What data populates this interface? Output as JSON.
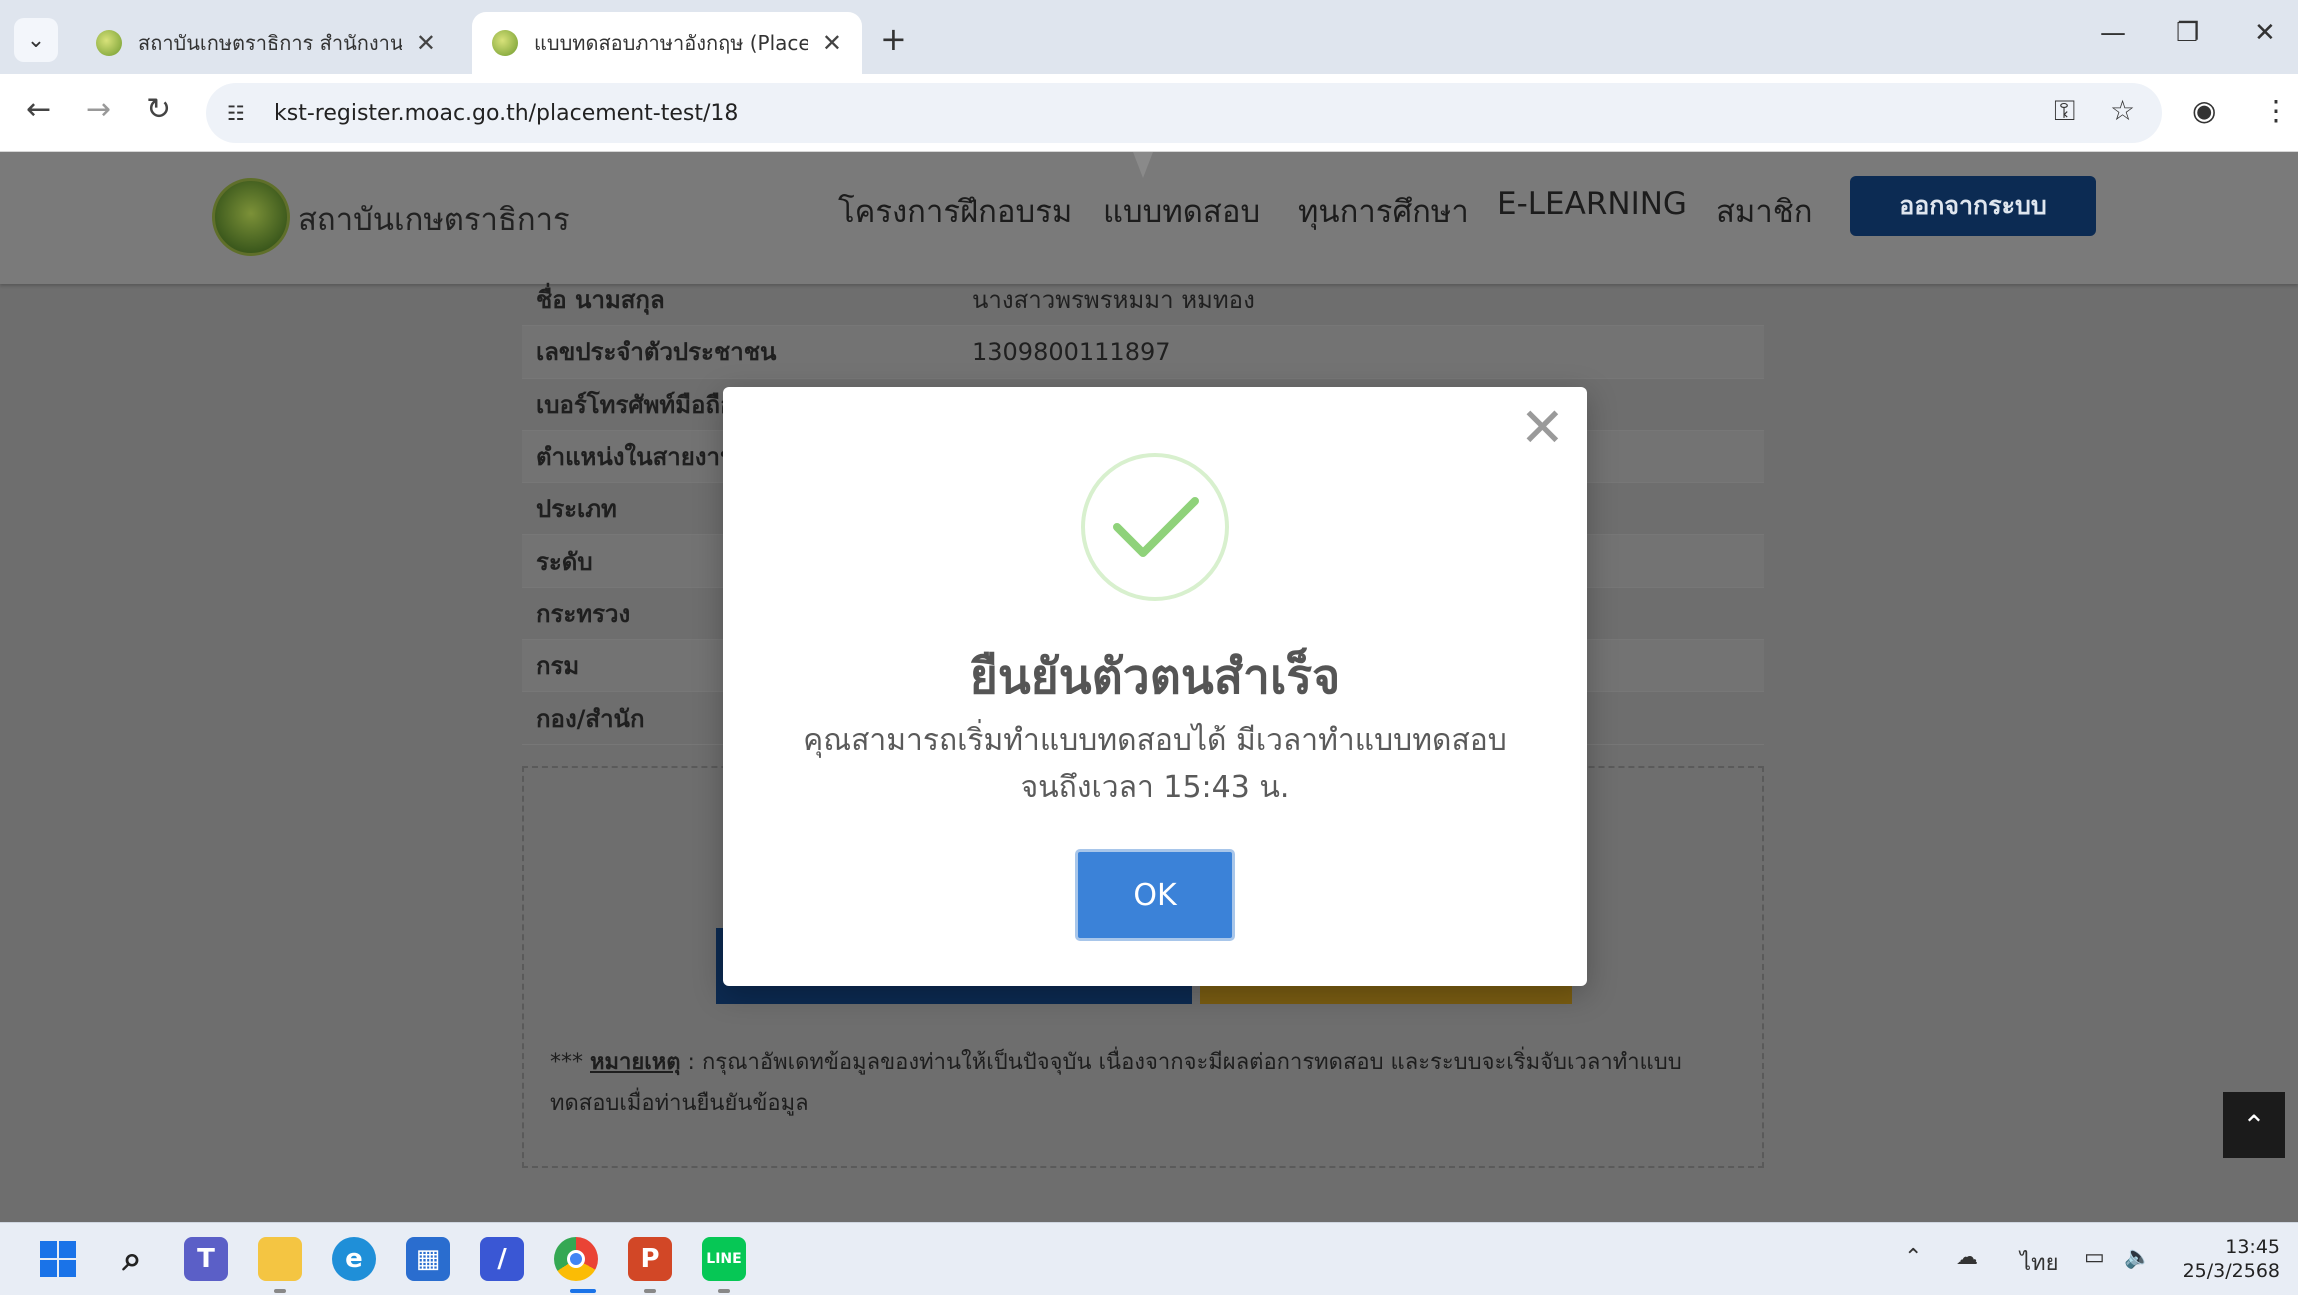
{
  "browser": {
    "tabs": [
      {
        "title": "สถาบันเกษตราธิการ สำนักงานปลัดก",
        "active": false
      },
      {
        "title": "แบบทดสอบภาษาอังกฤษ (Placemen",
        "active": true
      }
    ],
    "url": "kst-register.moac.go.th/placement-test/18"
  },
  "site": {
    "brand": "สถาบันเกษตราธิการ",
    "menu": [
      "โครงการฝึกอบรม",
      "แบบทดสอบ",
      "ทุนการศึกษา",
      "E-LEARNING",
      "สมาชิก"
    ],
    "logout": "ออกจากระบบ"
  },
  "profile_rows": [
    {
      "label": "ชื่อ นามสกุล",
      "value": "นางสาวพรพรหมมา หมทอง"
    },
    {
      "label": "เลขประจำตัวประชาชน",
      "value": "1309800111897"
    },
    {
      "label": "เบอร์โทรศัพท์มือถือ",
      "value": ""
    },
    {
      "label": "ตำแหน่งในสายงาน",
      "value": ""
    },
    {
      "label": "ประเภท",
      "value": ""
    },
    {
      "label": "ระดับ",
      "value": ""
    },
    {
      "label": "กระทรวง",
      "value": ""
    },
    {
      "label": "กรม",
      "value": ""
    },
    {
      "label": "กอง/สำนัก",
      "value": ""
    }
  ],
  "note": {
    "prefix": "***",
    "link": "หมายเหตุ",
    "text": " : กรุณาอัพเดทข้อมูลของท่านให้เป็นปัจจุบัน เนื่องจากจะมีผลต่อการทดสอบ และระบบจะเริ่มจับเวลาทำแบบทดสอบเมื่อท่านยืนยันข้อมูล"
  },
  "modal": {
    "title": "ยืนยันตัวตนสำเร็จ",
    "line1": "คุณสามารถเริ่มทำแบบทดสอบได้ มีเวลาทำแบบทดสอบ",
    "line2": "จนถึงเวลา 15:43 น.",
    "ok": "OK"
  },
  "taskbar": {
    "lang": "ไทย",
    "time": "13:45",
    "date": "25/3/2568"
  },
  "colors": {
    "logout_bg": "#0c2b53",
    "ok_button": "#3b82d8",
    "success_check": "#8fd27a"
  }
}
